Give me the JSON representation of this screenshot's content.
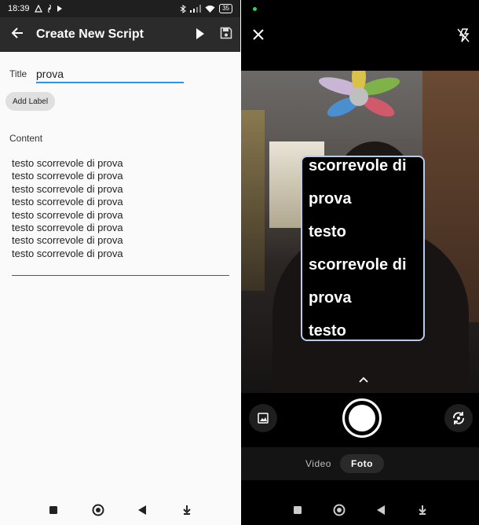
{
  "left_phone": {
    "status_bar": {
      "time": "18:39",
      "battery": "35"
    },
    "app_bar": {
      "title": "Create New Script"
    },
    "form": {
      "title_label": "Title",
      "title_value": "prova",
      "add_label_button": "Add Label",
      "content_label": "Content",
      "content_lines": [
        "testo scorrevole di prova",
        "testo scorrevole di prova",
        "testo scorrevole di prova",
        "testo scorrevole di prova",
        "testo scorrevole di prova",
        "testo scorrevole di prova",
        "testo scorrevole di prova",
        "testo scorrevole di prova"
      ]
    }
  },
  "right_phone": {
    "teleprompter_lines": [
      "scorrevole di",
      "prova",
      "testo",
      "scorrevole di",
      "prova",
      "testo"
    ],
    "modes": {
      "video": "Video",
      "photo": "Foto",
      "selected": "Foto"
    }
  },
  "colors": {
    "accent_blue": "#2196f3",
    "app_bar": "#2b2b2b",
    "teleprompter_border": "#b8cbe8"
  }
}
